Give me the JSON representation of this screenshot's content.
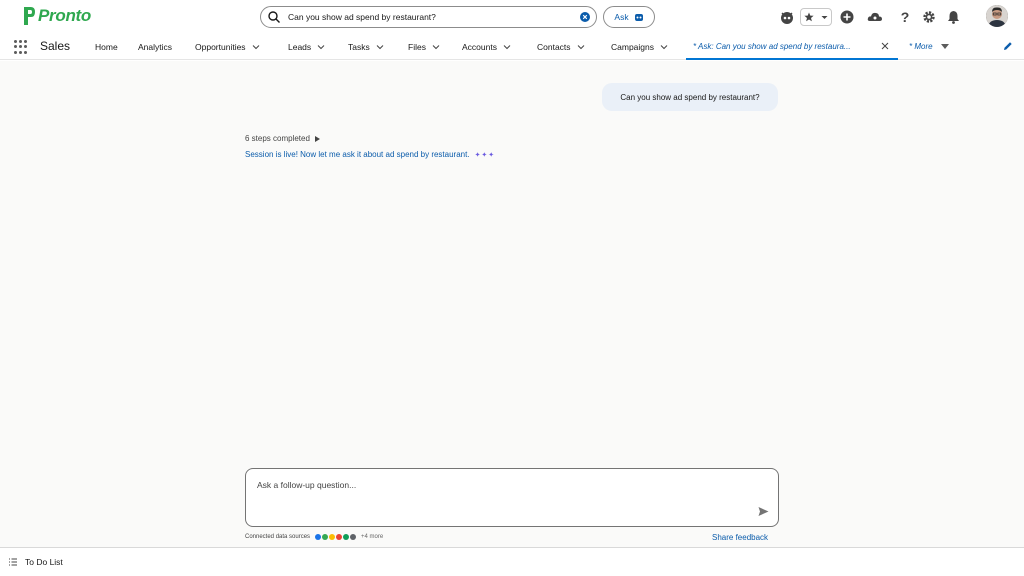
{
  "brand": {
    "name": "Pronto",
    "color": "#2fa84f"
  },
  "search": {
    "query": "Can you show ad spend by restaurant?",
    "ask_label": "Ask"
  },
  "header_icons": [
    "bot-icon",
    "star-icon",
    "chevron-down-icon",
    "add-icon",
    "cloud-help-icon",
    "help-icon",
    "gear-icon",
    "bell-icon"
  ],
  "nav": {
    "app_name": "Sales",
    "items": [
      {
        "label": "Home",
        "has_menu": false
      },
      {
        "label": "Analytics",
        "has_menu": false
      },
      {
        "label": "Opportunities",
        "has_menu": true
      },
      {
        "label": "Leads",
        "has_menu": true
      },
      {
        "label": "Tasks",
        "has_menu": true
      },
      {
        "label": "Files",
        "has_menu": true
      },
      {
        "label": "Accounts",
        "has_menu": true
      },
      {
        "label": "Contacts",
        "has_menu": true
      },
      {
        "label": "Campaigns",
        "has_menu": true
      }
    ],
    "active_tab": "* Ask: Can you show ad spend by restaura...",
    "more_label": "* More"
  },
  "chat": {
    "user_message": "Can you show ad spend by restaurant?",
    "steps_label": "6 steps completed",
    "status_message": "Session is live! Now let me ask it about ad spend by restaurant.",
    "followup_placeholder": "Ask a follow-up question...",
    "sources_label": "Connected data sources",
    "sources_more": "+4 more",
    "share_label": "Share feedback"
  },
  "footer": {
    "todo_label": "To Do List"
  },
  "colors": {
    "accent": "#0b5cab",
    "active_underline": "#0176d3",
    "bubble": "#eaf0f8"
  }
}
